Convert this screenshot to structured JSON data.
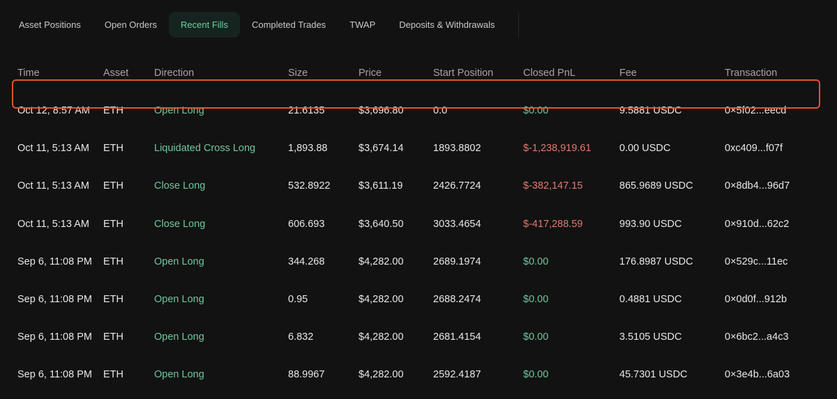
{
  "tabs": [
    {
      "label": "Asset Positions"
    },
    {
      "label": "Open Orders"
    },
    {
      "label": "Recent Fills"
    },
    {
      "label": "Completed Trades"
    },
    {
      "label": "TWAP"
    },
    {
      "label": "Deposits & Withdrawals"
    }
  ],
  "active_tab": "Recent Fills",
  "table": {
    "headers": [
      "Time",
      "Asset",
      "Direction",
      "Size",
      "Price",
      "Start Position",
      "Closed PnL",
      "Fee",
      "Transaction"
    ],
    "rows": [
      {
        "time": "Oct 12, 8:57 AM",
        "asset": "ETH",
        "direction": "Open Long",
        "size": "21.6135",
        "price": "$3,696.80",
        "start_position": "0.0",
        "closed_pnl": "$0.00",
        "fee": "9.5881 USDC",
        "transaction": "0×5f02...eecd"
      },
      {
        "time": "Oct 11, 5:13 AM",
        "asset": "ETH",
        "direction": "Liquidated Cross Long",
        "size": "1,893.88",
        "price": "$3,674.14",
        "start_position": "1893.8802",
        "closed_pnl": "$-1,238,919.61",
        "fee": "0.00 USDC",
        "transaction": "0xc409...f07f"
      },
      {
        "time": "Oct 11, 5:13 AM",
        "asset": "ETH",
        "direction": "Close Long",
        "size": "532.8922",
        "price": "$3,611.19",
        "start_position": "2426.7724",
        "closed_pnl": "$-382,147.15",
        "fee": "865.9689 USDC",
        "transaction": "0×8db4...96d7"
      },
      {
        "time": "Oct 11, 5:13 AM",
        "asset": "ETH",
        "direction": "Close Long",
        "size": "606.693",
        "price": "$3,640.50",
        "start_position": "3033.4654",
        "closed_pnl": "$-417,288.59",
        "fee": "993.90 USDC",
        "transaction": "0×910d...62c2"
      },
      {
        "time": "Sep 6, 11:08 PM",
        "asset": "ETH",
        "direction": "Open Long",
        "size": "344.268",
        "price": "$4,282.00",
        "start_position": "2689.1974",
        "closed_pnl": "$0.00",
        "fee": "176.8987 USDC",
        "transaction": "0×529c...11ec"
      },
      {
        "time": "Sep 6, 11:08 PM",
        "asset": "ETH",
        "direction": "Open Long",
        "size": "0.95",
        "price": "$4,282.00",
        "start_position": "2688.2474",
        "closed_pnl": "$0.00",
        "fee": "0.4881 USDC",
        "transaction": "0×0d0f...912b"
      },
      {
        "time": "Sep 6, 11:08 PM",
        "asset": "ETH",
        "direction": "Open Long",
        "size": "6.832",
        "price": "$4,282.00",
        "start_position": "2681.4154",
        "closed_pnl": "$0.00",
        "fee": "3.5105 USDC",
        "transaction": "0×6bc2...a4c3"
      },
      {
        "time": "Sep 6, 11:08 PM",
        "asset": "ETH",
        "direction": "Open Long",
        "size": "88.9967",
        "price": "$4,282.00",
        "start_position": "2592.4187",
        "closed_pnl": "$0.00",
        "fee": "45.7301 USDC",
        "transaction": "0×3e4b...6a03"
      }
    ]
  },
  "colors": {
    "background": "#121212",
    "positive": "#71c79d",
    "negative": "#e07a6f",
    "highlight_border": "#e0542f",
    "active_tab_bg": "#16241f"
  }
}
